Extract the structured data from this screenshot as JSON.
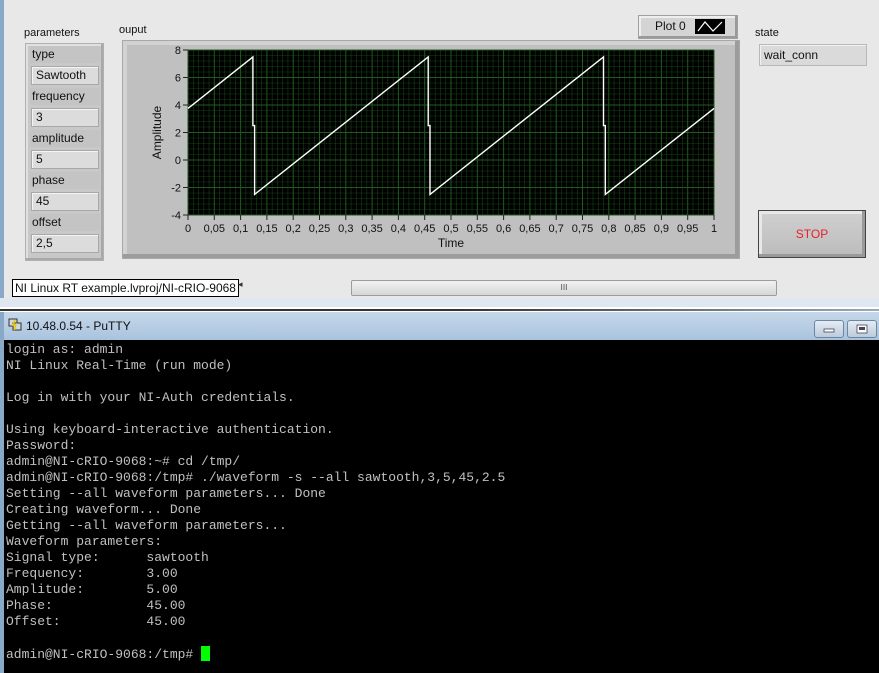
{
  "labview": {
    "parameters_label": "parameters",
    "params": [
      {
        "name": "type",
        "value": "Sawtooth"
      },
      {
        "name": "frequency",
        "value": "3"
      },
      {
        "name": "amplitude",
        "value": "5"
      },
      {
        "name": "phase",
        "value": "45"
      },
      {
        "name": "offset",
        "value": "2,5"
      }
    ],
    "graph_label": "ouput",
    "plot_legend": "Plot 0",
    "state_label": "state",
    "state_value": "wait_conn",
    "stop_label": "STOP",
    "project_path": "NI Linux RT example.lvproj/NI-cRIO-9068",
    "scroll_left_arrow": "◂",
    "scroll_grip": "III"
  },
  "chart_data": {
    "type": "line",
    "title": "ouput",
    "xlabel": "Time",
    "ylabel": "Amplitude",
    "xlim": [
      0,
      1
    ],
    "ylim": [
      -4,
      8
    ],
    "x_ticks": [
      "0",
      "0,05",
      "0,1",
      "0,15",
      "0,2",
      "0,25",
      "0,3",
      "0,35",
      "0,4",
      "0,45",
      "0,5",
      "0,55",
      "0,6",
      "0,65",
      "0,7",
      "0,75",
      "0,8",
      "0,85",
      "0,9",
      "0,95",
      "1"
    ],
    "y_ticks": [
      "8",
      "6",
      "4",
      "2",
      "0",
      "-2",
      "-4"
    ],
    "grid": true,
    "background": "#000000",
    "grid_color": "#1f5a1f",
    "line_color": "#ffffff",
    "legend": "top-right",
    "series": [
      {
        "name": "Plot 0",
        "points": [
          [
            0,
            3.75
          ],
          [
            0.1233,
            7.5
          ],
          [
            0.1233,
            2.5
          ],
          [
            0.1266,
            2.5
          ],
          [
            0.1266,
            -2.5
          ],
          [
            0.4566,
            7.5
          ],
          [
            0.4566,
            2.5
          ],
          [
            0.46,
            2.5
          ],
          [
            0.46,
            -2.5
          ],
          [
            0.79,
            7.5
          ],
          [
            0.79,
            2.5
          ],
          [
            0.7933,
            2.5
          ],
          [
            0.7933,
            -2.5
          ],
          [
            1,
            3.75
          ]
        ]
      }
    ]
  },
  "putty": {
    "title": "10.48.0.54 - PuTTY",
    "lines": [
      "login as: admin",
      "NI Linux Real-Time (run mode)",
      "",
      "Log in with your NI-Auth credentials.",
      "",
      "Using keyboard-interactive authentication.",
      "Password:",
      "admin@NI-cRIO-9068:~# cd /tmp/",
      "admin@NI-cRIO-9068:/tmp# ./waveform -s --all sawtooth,3,5,45,2.5",
      "Setting --all waveform parameters... Done",
      "Creating waveform... Done",
      "Getting --all waveform parameters...",
      "Waveform parameters:",
      "Signal type:      sawtooth",
      "Frequency:        3.00",
      "Amplitude:        5.00",
      "Phase:            45.00",
      "Offset:           45.00",
      ""
    ],
    "prompt": "admin@NI-cRIO-9068:/tmp# ",
    "cursor_color": "#00ff00"
  }
}
